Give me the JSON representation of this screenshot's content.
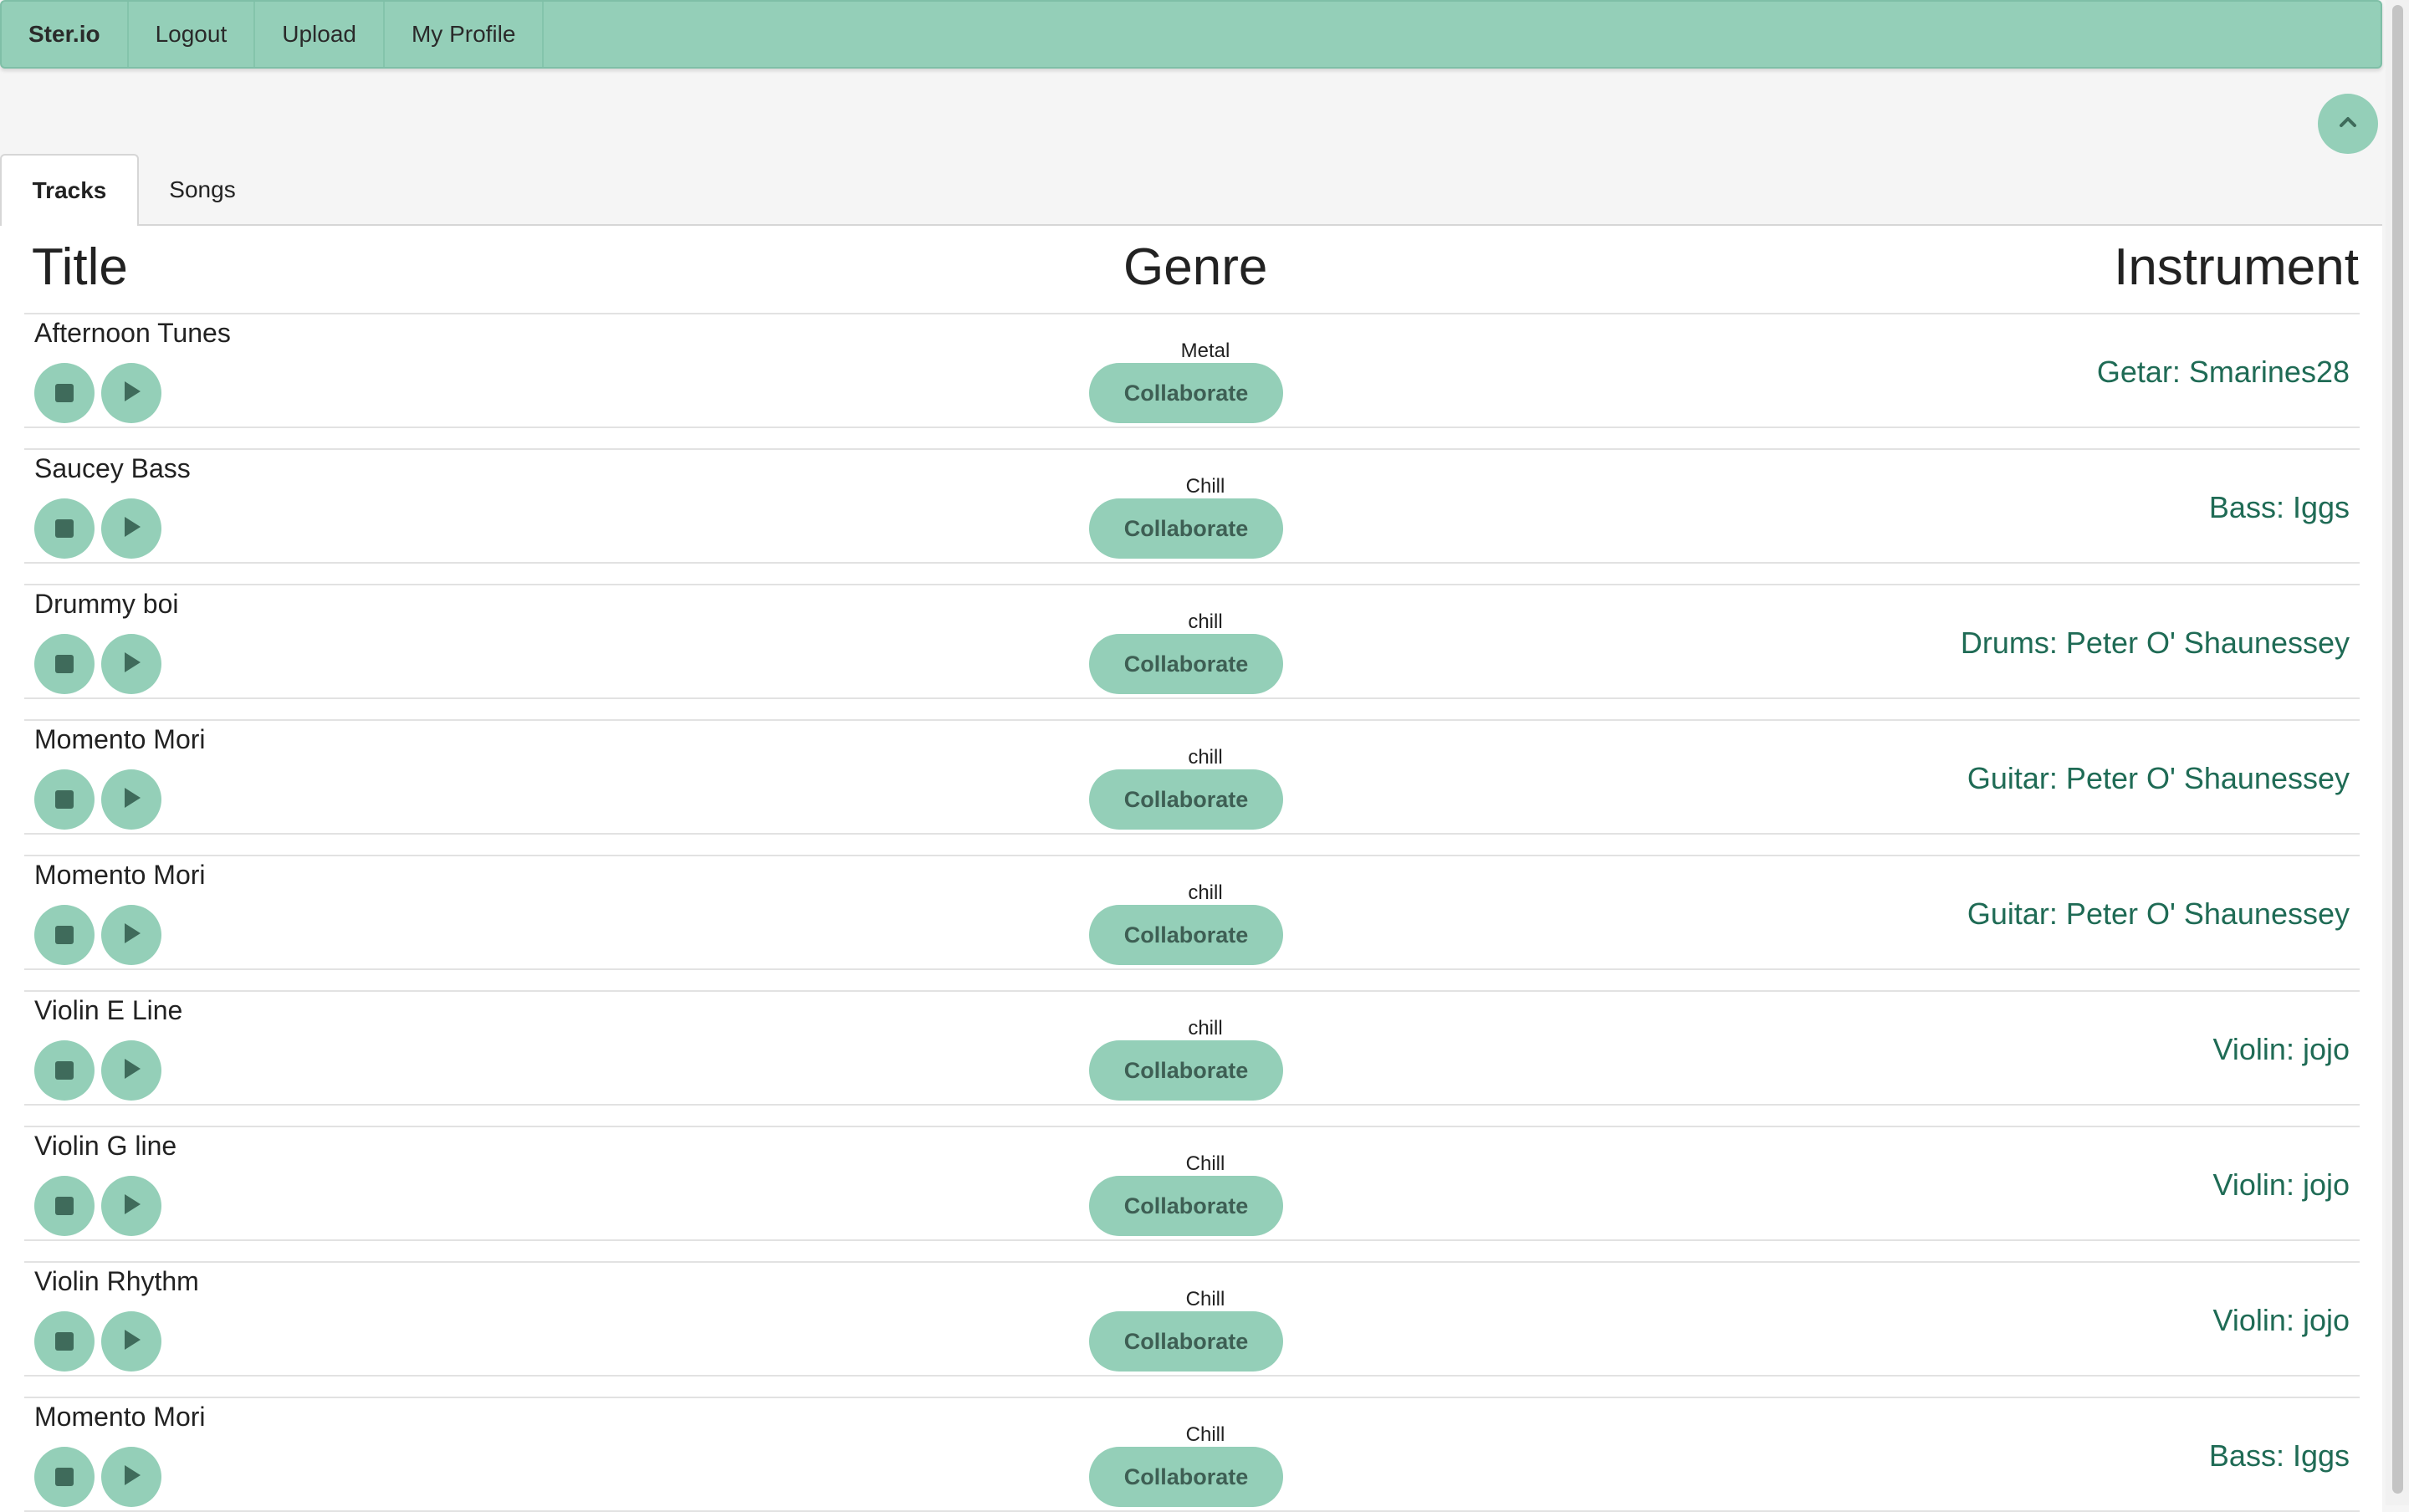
{
  "navbar": {
    "brand": "Ster.io",
    "items": [
      "Logout",
      "Upload",
      "My Profile"
    ]
  },
  "tabs": [
    {
      "label": "Tracks",
      "active": true
    },
    {
      "label": "Songs",
      "active": false
    }
  ],
  "table": {
    "headers": {
      "title": "Title",
      "genre": "Genre",
      "instrument": "Instrument"
    },
    "collaborate_label": "Collaborate",
    "rows": [
      {
        "title": "Afternoon Tunes",
        "genre": "Metal",
        "instrument": "Getar: Smarines28"
      },
      {
        "title": "Saucey Bass",
        "genre": "Chill",
        "instrument": "Bass: Iggs"
      },
      {
        "title": "Drummy boi",
        "genre": "chill",
        "instrument": "Drums: Peter O' Shaunessey"
      },
      {
        "title": "Momento Mori",
        "genre": "chill",
        "instrument": "Guitar: Peter O' Shaunessey"
      },
      {
        "title": "Momento Mori",
        "genre": "chill",
        "instrument": "Guitar: Peter O' Shaunessey"
      },
      {
        "title": "Violin E Line",
        "genre": "chill",
        "instrument": "Violin: jojo"
      },
      {
        "title": "Violin G line",
        "genre": "Chill",
        "instrument": "Violin: jojo"
      },
      {
        "title": "Violin Rhythm",
        "genre": "Chill",
        "instrument": "Violin: jojo"
      },
      {
        "title": "Momento Mori",
        "genre": "Chill",
        "instrument": "Bass: Iggs"
      }
    ]
  },
  "colors": {
    "accent": "#94cfb8",
    "instrument_link": "#1f6b55",
    "icon_dark": "#3f6b5b"
  }
}
